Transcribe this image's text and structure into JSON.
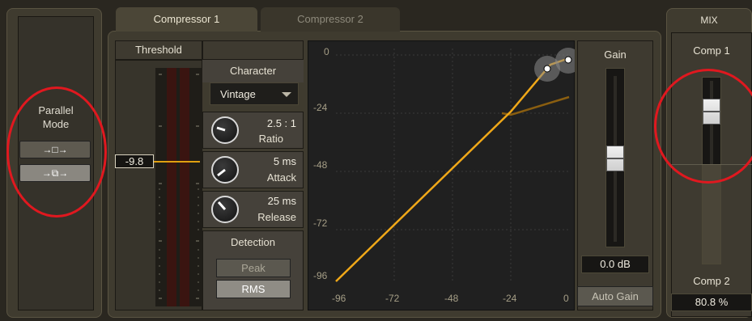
{
  "tabs": [
    {
      "label": "Compressor 1",
      "active": true
    },
    {
      "label": "Compressor 2",
      "active": false
    }
  ],
  "parallel_mode": {
    "title_line1": "Parallel",
    "title_line2": "Mode",
    "buttons": [
      {
        "icon": "serial-routing-icon",
        "glyph": "→□→",
        "selected": false
      },
      {
        "icon": "parallel-routing-icon",
        "glyph": "→⧉→",
        "selected": true
      }
    ]
  },
  "threshold": {
    "label": "Threshold",
    "value": "-9.8"
  },
  "character": {
    "label": "Character",
    "selected": "Vintage"
  },
  "knobs": [
    {
      "id": "ratio",
      "value": "2.5 : 1",
      "label": "Ratio"
    },
    {
      "id": "attack",
      "value": "5 ms",
      "label": "Attack"
    },
    {
      "id": "release",
      "value": "25 ms",
      "label": "Release"
    }
  ],
  "detection": {
    "label": "Detection",
    "options": [
      {
        "label": "Peak",
        "selected": false
      },
      {
        "label": "RMS",
        "selected": true
      }
    ]
  },
  "graph": {
    "y_ticks": [
      "0",
      "-24",
      "-48",
      "-72",
      "-96"
    ],
    "x_ticks": [
      "-96",
      "-72",
      "-48",
      "-24",
      "0"
    ],
    "curve_color": "#f0a818"
  },
  "gain": {
    "label": "Gain",
    "value": "0.0",
    "unit": "dB",
    "auto_gain_label": "Auto Gain"
  },
  "mix": {
    "label": "MIX",
    "top_label": "Comp 1",
    "bottom_label": "Comp 2",
    "value": "80.8",
    "unit": "%"
  }
}
